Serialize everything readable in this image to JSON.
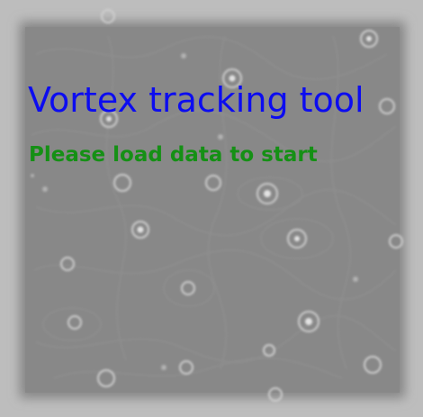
{
  "splash": {
    "title": "Vortex tracking tool",
    "status_message": "Please load data to start",
    "background_image": "vortex-flow-field",
    "colors": {
      "title": "#0c0cf0",
      "status": "#159015",
      "frame": "#bdbdbd",
      "field": "#8a8a8a"
    }
  }
}
